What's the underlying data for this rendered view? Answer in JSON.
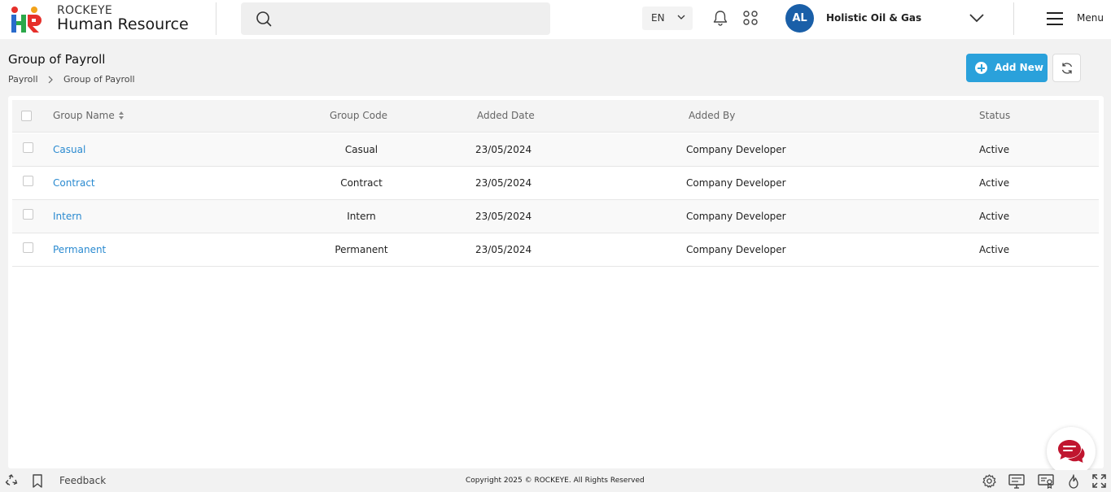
{
  "header": {
    "brand_top": "ROCKEYE",
    "brand_main": "Human Resource",
    "language": "EN",
    "avatar_initials": "AL",
    "company_name": "Holistic Oil & Gas",
    "menu_label": "Menu"
  },
  "page": {
    "title": "Group of Payroll",
    "breadcrumb": [
      "Payroll",
      "Group of Payroll"
    ],
    "add_button_label": "Add New"
  },
  "table": {
    "columns": [
      "Group Name",
      "Group Code",
      "Added Date",
      "Added By",
      "Status"
    ],
    "rows": [
      {
        "group_name": "Casual",
        "group_code": "Casual",
        "added_date": "23/05/2024",
        "added_by": "Company Developer",
        "status": "Active"
      },
      {
        "group_name": "Contract",
        "group_code": "Contract",
        "added_date": "23/05/2024",
        "added_by": "Company Developer",
        "status": "Active"
      },
      {
        "group_name": "Intern",
        "group_code": "Intern",
        "added_date": "23/05/2024",
        "added_by": "Company Developer",
        "status": "Active"
      },
      {
        "group_name": "Permanent",
        "group_code": "Permanent",
        "added_date": "23/05/2024",
        "added_by": "Company Developer",
        "status": "Active"
      }
    ]
  },
  "footer": {
    "feedback_label": "Feedback",
    "copyright": "Copyright 2025 © ROCKEYE. All Rights Reserved"
  },
  "icons": {
    "search": "search-icon",
    "notification": "bell-icon",
    "apps": "apps-grid-icon",
    "menu": "hamburger-icon",
    "refresh": "refresh-icon",
    "chat": "chat-icon",
    "recycle": "recycle-icon",
    "bookmark": "bookmark-icon",
    "settings": "gear-icon",
    "monitor": "monitor-icon",
    "certificate": "certificate-icon",
    "fire": "fire-icon",
    "fullscreen": "fullscreen-icon"
  },
  "colors": {
    "accent": "#2aa1db",
    "avatar": "#1a5fa8",
    "link": "#2a8ad0",
    "chat": "#c0152f"
  }
}
